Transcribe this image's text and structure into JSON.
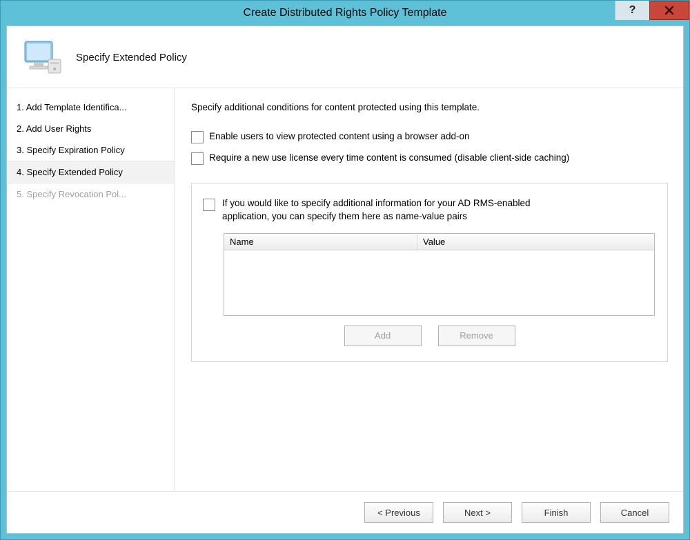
{
  "window": {
    "title": "Create Distributed Rights Policy Template"
  },
  "header": {
    "subtitle": "Specify Extended Policy"
  },
  "sidebar": {
    "items": [
      {
        "label": "1. Add Template Identifica...",
        "state": "normal"
      },
      {
        "label": "2. Add User Rights",
        "state": "normal"
      },
      {
        "label": "3. Specify Expiration Policy",
        "state": "normal"
      },
      {
        "label": "4. Specify Extended Policy",
        "state": "active"
      },
      {
        "label": "5. Specify Revocation Pol...",
        "state": "disabled"
      }
    ]
  },
  "content": {
    "intro": "Specify additional conditions for content protected using this template.",
    "checkbox1_label": "Enable users to view protected content using a browser add-on",
    "checkbox2_label": "Require a new use license every time content is consumed (disable client-side caching)",
    "group_label": "If you would like to specify additional information for your AD RMS-enabled application, you can specify them here as name-value pairs",
    "table": {
      "col_name": "Name",
      "col_value": "Value"
    },
    "add_label": "Add",
    "remove_label": "Remove"
  },
  "footer": {
    "previous": "< Previous",
    "next": "Next >",
    "finish": "Finish",
    "cancel": "Cancel"
  }
}
